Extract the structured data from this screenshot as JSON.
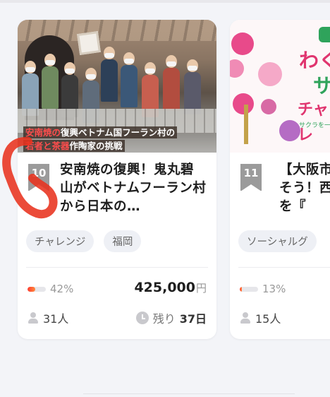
{
  "cards": [
    {
      "rank": "10",
      "image_caption": {
        "line1_accent": "安南焼の",
        "line1_rest": "復興ベトナム国フーラン村の",
        "line2_accent": "若者と茶器",
        "line2_rest": "作陶家の挑戦"
      },
      "title": "安南焼の復興！鬼丸碧山がベトナムフーラン村から日本の…",
      "tags": [
        "チャレンジ",
        "福岡"
      ],
      "progress_percent": 42,
      "progress_label": "42%",
      "amount": "425,000",
      "currency": "円",
      "supporters": "31人",
      "remaining_label": "残り",
      "remaining_value": "37日"
    },
    {
      "rank": "11",
      "image_text": {
        "line1": "わく",
        "line2": "サ",
        "line3": "チャレ",
        "small": "サクラを一緒"
      },
      "title": "【大阪市かそう！西口を『",
      "tags": [
        "ソーシャルグ"
      ],
      "progress_percent": 13,
      "progress_label": "13%",
      "supporters": "15人"
    }
  ],
  "colors": {
    "progress_start": "#ff3b30",
    "progress_end": "#ff8a3d",
    "rank_badge": "#9b9b9b",
    "tag_bg": "#eef0f5",
    "annotation_scribble": "#e8321e"
  }
}
